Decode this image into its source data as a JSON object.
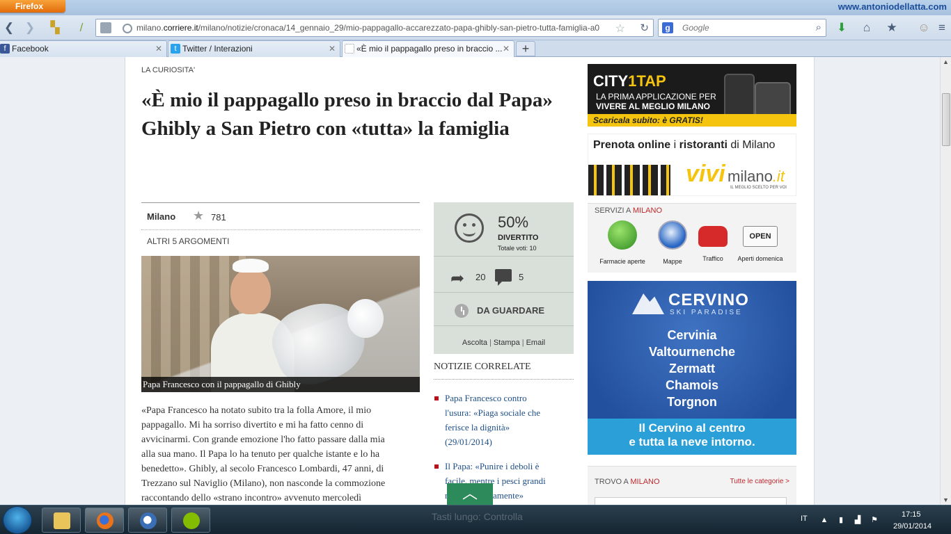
{
  "browser": {
    "menu_button": "Firefox",
    "watermark": "www.antoniodellatta.com",
    "url_prefix": "milano.",
    "url_domain": "corriere.it",
    "url_path": "/milano/notizie/cronaca/14_gennaio_29/mio-pappagallo-accarezzato-papa-ghibly-san-pietro-tutta-famiglia-a0",
    "search_engine_label": "g",
    "search_placeholder": "Google",
    "tabs": [
      {
        "label": "Facebook",
        "favicon": "facebook-icon"
      },
      {
        "label": "Twitter / Interazioni",
        "favicon": "twitter-icon"
      },
      {
        "label": "«È mio il pappagallo preso in braccio ...",
        "favicon": "blank-page-icon"
      }
    ],
    "new_tab": "+"
  },
  "article": {
    "kicker": "LA CURIOSITA'",
    "headline_line1": "«È mio il pappagallo preso in braccio dal Papa»",
    "headline_line2": "Ghibly a San Pietro con «tutta» la famiglia",
    "city": "Milano",
    "rating_count": "781",
    "more_topics": "ALTRI 5 ARGOMENTI",
    "photo_caption": "Papa Francesco con il pappagallo di Ghibly",
    "body_lines": [
      "«Papa Francesco ha notato subito tra la folla Amore, il mio",
      "pappagallo. Mi ha sorriso divertito e mi ha fatto cenno di",
      "avvicinarmi. Con grande emozione l'ho fatto passare dalla mia",
      "alla sua mano. Il Papa lo ha tenuto per qualche istante e lo ha",
      "benedetto». Ghibly, al secolo Francesco Lombardi, 47 anni, di",
      "Trezzano sul Naviglio (Milano), non nasconde la commozione",
      "raccontando dello «strano incontro» avvenuto mercoledì"
    ]
  },
  "vote_panel": {
    "percent": "50%",
    "label": "DIVERTITO",
    "total": "Totale voti: 10",
    "shares": "20",
    "comments": "5",
    "watch_label": "DA GUARDARE",
    "links": [
      "Ascolta",
      "Stampa",
      "Email"
    ]
  },
  "related": {
    "title": "NOTIZIE CORRELATE",
    "items": [
      [
        "Papa Francesco contro",
        "l'usura: «Piaga sociale che",
        "ferisce la dignità»",
        "(29/01/2014)"
      ],
      [
        "Il Papa: «Punire i deboli è",
        "facile, mentre i pesci grandi",
        "nuotano liberamente»"
      ]
    ]
  },
  "back_to_top": "︿",
  "ads": {
    "city_logo_a": "CITY",
    "city_logo_b": "1TAP",
    "city_line1": "LA PRIMA APPLICAZIONE PER",
    "city_line2": "VIVERE AL MEGLIO MILANO",
    "city_strip": "Scaricala subito: è GRATIS!",
    "vivi_header_bold1": "Prenota online",
    "vivi_header_mid": " i ",
    "vivi_header_bold2": "ristoranti",
    "vivi_header_end": " di Milano",
    "vivi_logo": "vivi",
    "vivi_city": "milano",
    "vivi_tld": ".it",
    "vivi_tagline": "IL MEGLIO SCELTO PER VOI",
    "cervino_brand": "CERVINO",
    "cervino_sub": "SKI PARADISE",
    "cervino_places": [
      "Cervinia",
      "Valtournenche",
      "Zermatt",
      "Chamois",
      "Torgnon"
    ],
    "cervino_band1": "Il Cervino al centro",
    "cervino_band2": "e tutta la neve intorno."
  },
  "services": {
    "title_prefix": "SERVIZI A ",
    "title_city": "MILANO",
    "items": [
      {
        "label": "Farmacie aperte",
        "icon": "pharmacy-icon"
      },
      {
        "label": "Mappe",
        "icon": "compass-icon"
      },
      {
        "label": "Traffico",
        "icon": "car-icon"
      },
      {
        "label": "Aperti domenica",
        "icon": "open-sign-icon",
        "sign": "OPEN"
      }
    ]
  },
  "trovo": {
    "title_prefix": "TROVO A ",
    "title_city": "MILANO",
    "all_link": "Tutte le categorie >"
  },
  "taskbar": {
    "language": "IT",
    "time": "17:15",
    "date": "29/01/2014",
    "ghost_text": "Tasti lungo: Controlla"
  },
  "colors": {
    "accent_red": "#c0282d",
    "link_blue": "#1f4f87",
    "vote_panel_bg": "#d9dfd9",
    "back_to_top_green": "#2d8a5a"
  }
}
